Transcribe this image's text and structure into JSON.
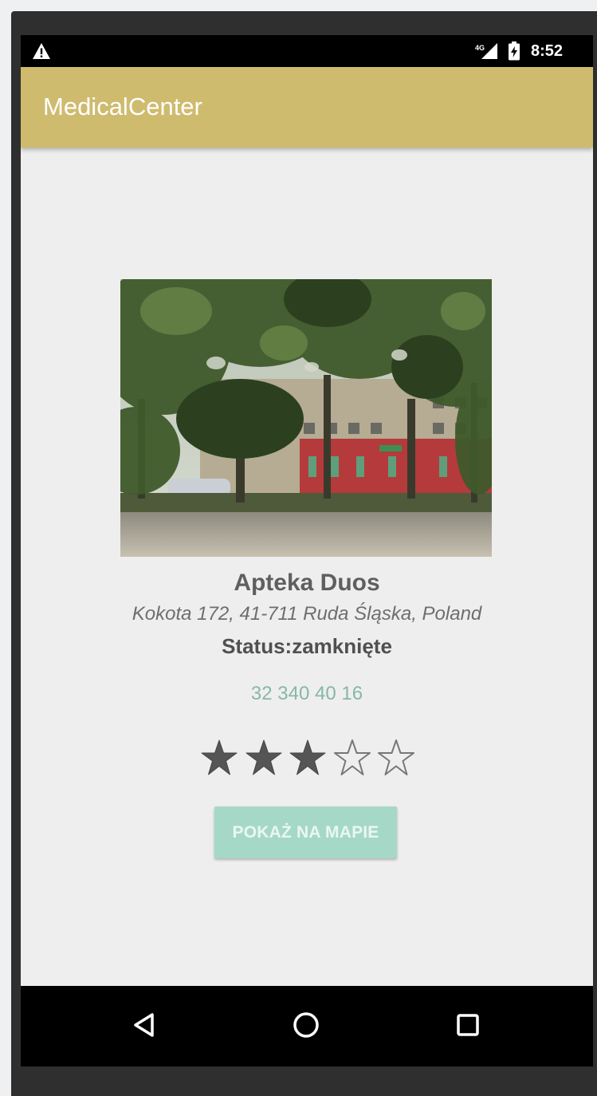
{
  "status_bar": {
    "time": "8:52",
    "icons": [
      "warning-icon",
      "signal-icon",
      "battery-icon"
    ]
  },
  "app_bar": {
    "title": "MedicalCenter",
    "color": "#cfbb6e"
  },
  "place": {
    "name": "Apteka Duos",
    "address": "Kokota 172, 41-711 Ruda Śląska, Poland",
    "status": "Status:zamknięte",
    "phone": "32 340 40 16",
    "phone_color": "#87b8a4",
    "rating": 3,
    "rating_max": 5
  },
  "map_button": {
    "label": "POKAŻ NA MAPIE",
    "color": "#a6d8c8"
  },
  "nav_bar": {
    "icons": [
      "back-icon",
      "home-icon",
      "recents-icon"
    ]
  }
}
